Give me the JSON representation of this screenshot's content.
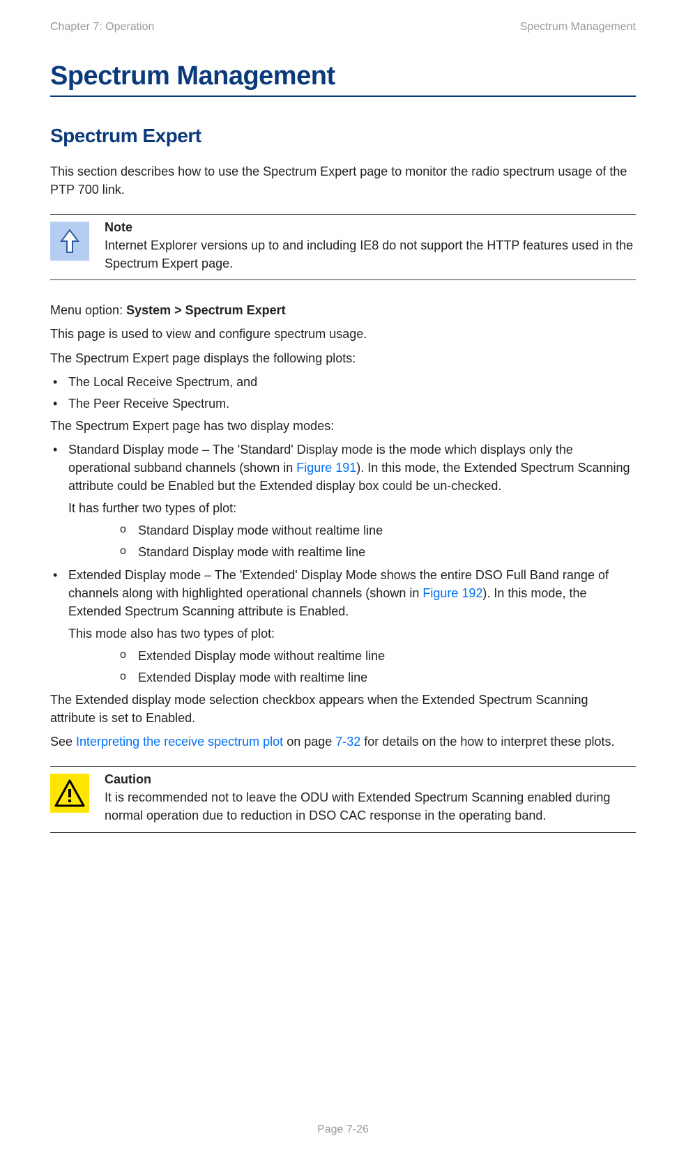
{
  "header": {
    "left": "Chapter 7:  Operation",
    "right": "Spectrum Management"
  },
  "h1": "Spectrum Management",
  "h2": "Spectrum Expert",
  "intro": "This section describes how to use the Spectrum Expert page to monitor the radio spectrum usage of the PTP 700 link.",
  "note": {
    "title": "Note",
    "body": "Internet Explorer versions up to and including IE8 do not support the HTTP features used in the Spectrum Expert page."
  },
  "menu_label": "Menu option: ",
  "menu_path": "System > Spectrum Expert",
  "p2": "This page is used to view and configure spectrum usage.",
  "p3": "The Spectrum Expert page displays the following plots:",
  "bullets1": [
    "The Local Receive Spectrum, and",
    "The Peer Receive Spectrum."
  ],
  "p4": "The Spectrum Expert page has two display modes:",
  "std": {
    "lead_pre": "Standard Display mode – The 'Standard' Display mode is the mode which displays only the operational subband channels (shown in ",
    "link": "Figure 191",
    "lead_post": "). In this mode, the Extended Spectrum Scanning attribute could be Enabled but the Extended display box could be un-checked.",
    "sub_lead": "It has further two types of plot:",
    "items": [
      "Standard Display mode without realtime line",
      "Standard Display mode with realtime line"
    ]
  },
  "ext": {
    "lead_pre": "Extended Display mode – The 'Extended' Display Mode shows the entire DSO Full Band range of channels along with highlighted operational channels (shown in ",
    "link": "Figure 192",
    "lead_post": "). In this mode, the Extended Spectrum Scanning attribute is Enabled.",
    "sub_lead": "This mode also has two types of plot:",
    "items": [
      "Extended Display mode without realtime line",
      "Extended Display mode with realtime line"
    ]
  },
  "p5": "The Extended display mode selection checkbox appears when the Extended Spectrum Scanning attribute is set to Enabled.",
  "see": {
    "pre": "See ",
    "link": "Interpreting the receive spectrum plot",
    "mid": " on page ",
    "page": "7-32",
    "post": " for details on the how to interpret these plots."
  },
  "caution": {
    "title": "Caution",
    "body": "It is recommended not to leave the ODU with Extended Spectrum Scanning enabled during normal operation due to reduction in DSO CAC response in the operating band."
  },
  "footer": "Page 7-26"
}
